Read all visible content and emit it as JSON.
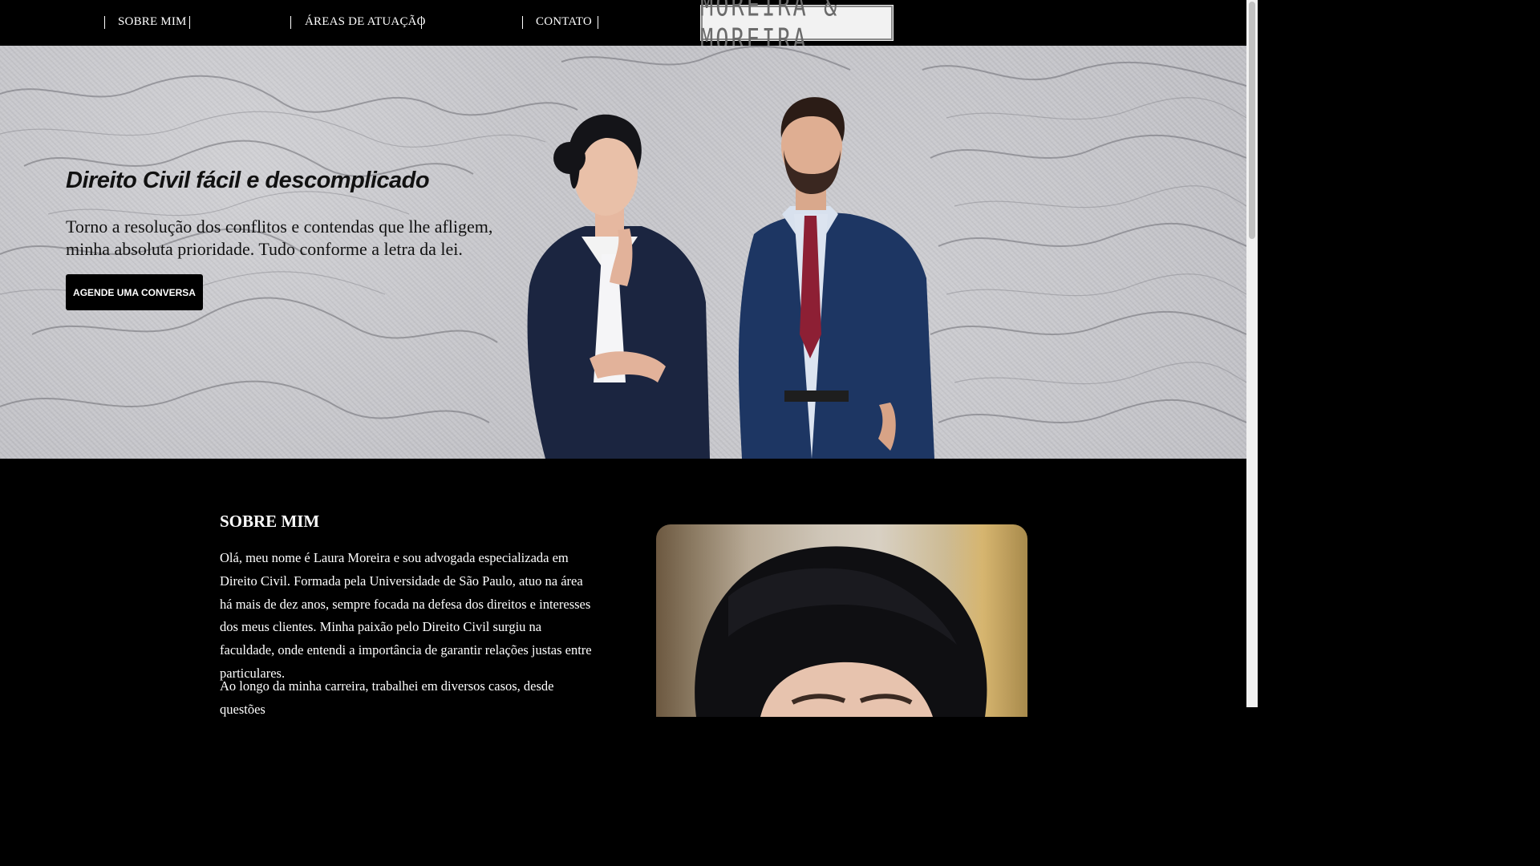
{
  "nav": {
    "items": [
      {
        "label": "SOBRE MIM"
      },
      {
        "label": "ÁREAS DE ATUAÇÃO"
      },
      {
        "label": "CONTATO"
      }
    ],
    "logo_text": "MOREIRA & MOREIRA"
  },
  "hero": {
    "title": "Direito Civil fácil e descomplicado",
    "subtitle": "Torno a resolução dos conflitos e contendas que lhe afligem, minha absoluta prioridade. Tudo conforme a letra da lei.",
    "cta_label": "AGENDE UMA CONVERSA"
  },
  "about": {
    "title": "SOBRE MIM",
    "paragraph1": "Olá, meu nome é Laura Moreira e sou advogada especializada em Direito Civil. Formada pela Universidade de São Paulo, atuo na área há mais de dez anos, sempre focada na defesa dos direitos e interesses dos meus clientes. Minha paixão pelo Direito Civil surgiu na faculdade, onde entendi a importância de garantir relações justas entre particulares.",
    "paragraph2": "Ao longo da minha carreira, trabalhei em diversos casos, desde questões"
  },
  "colors": {
    "nav_bg": "#000000",
    "hero_bg": "#c3c3c8",
    "button_bg": "#000000",
    "about_bg": "#000000"
  }
}
